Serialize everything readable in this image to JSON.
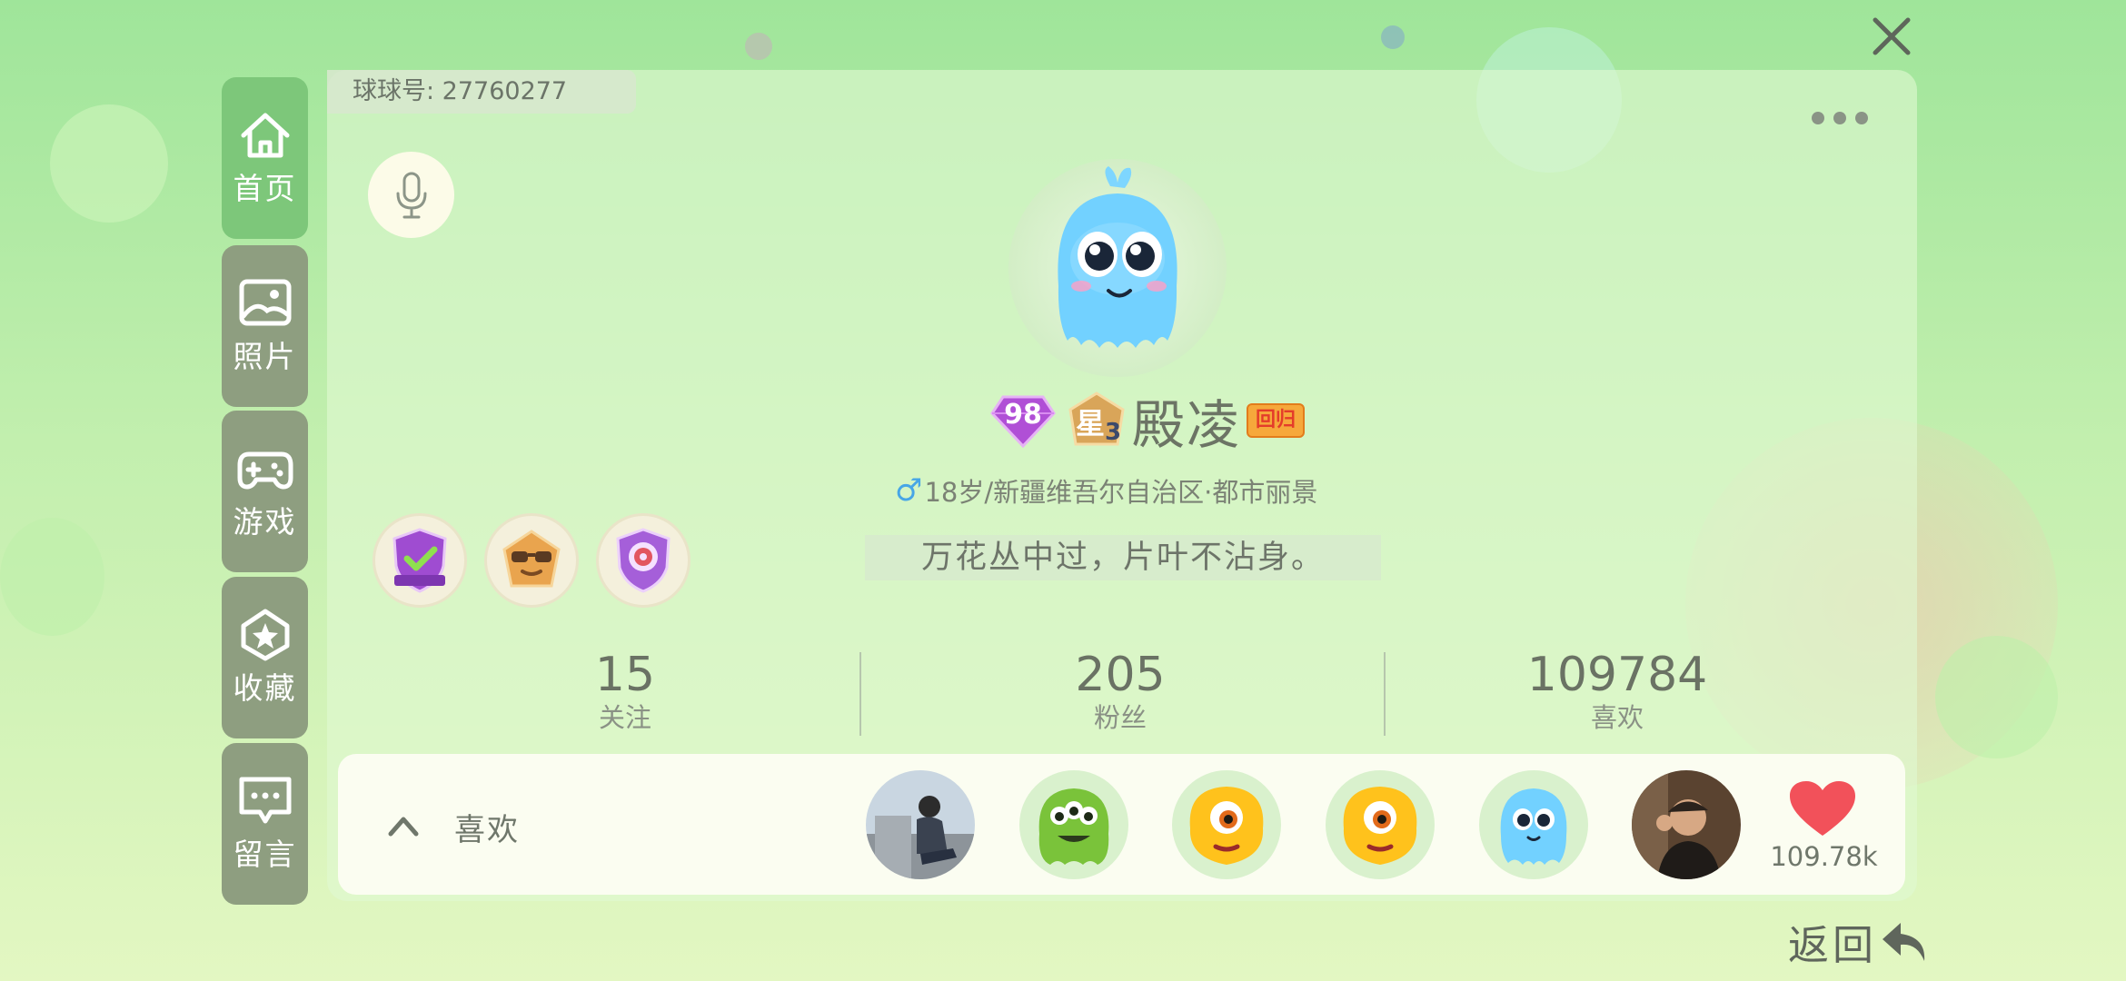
{
  "profile": {
    "id_text": "球球号: 27760277",
    "level": "98",
    "star_text": "星",
    "star_level": "3",
    "name": "殿凌",
    "return_tag": "回归",
    "gender_symbol": "♂",
    "info": "18岁/新疆维吾尔自治区·都市丽景",
    "signature": "万花丛中过，片叶不沾身。"
  },
  "nav": {
    "items": [
      {
        "label": "首页",
        "icon": "home-icon",
        "active": true
      },
      {
        "label": "照片",
        "icon": "photo-icon",
        "active": false
      },
      {
        "label": "游戏",
        "icon": "gamepad-icon",
        "active": false
      },
      {
        "label": "收藏",
        "icon": "star-icon",
        "active": false
      },
      {
        "label": "留言",
        "icon": "message-icon",
        "active": false
      }
    ]
  },
  "stats": [
    {
      "value": "15",
      "label": "关注"
    },
    {
      "value": "205",
      "label": "粉丝"
    },
    {
      "value": "109784",
      "label": "喜欢"
    }
  ],
  "likes": {
    "title": "喜欢",
    "count": "109.78k"
  },
  "back_label": "返回",
  "colors": {
    "accent_green": "#7dc77a",
    "nav_inactive": "#8e9e80",
    "heart": "#f2515a",
    "level_purple": "#b04fd6"
  }
}
